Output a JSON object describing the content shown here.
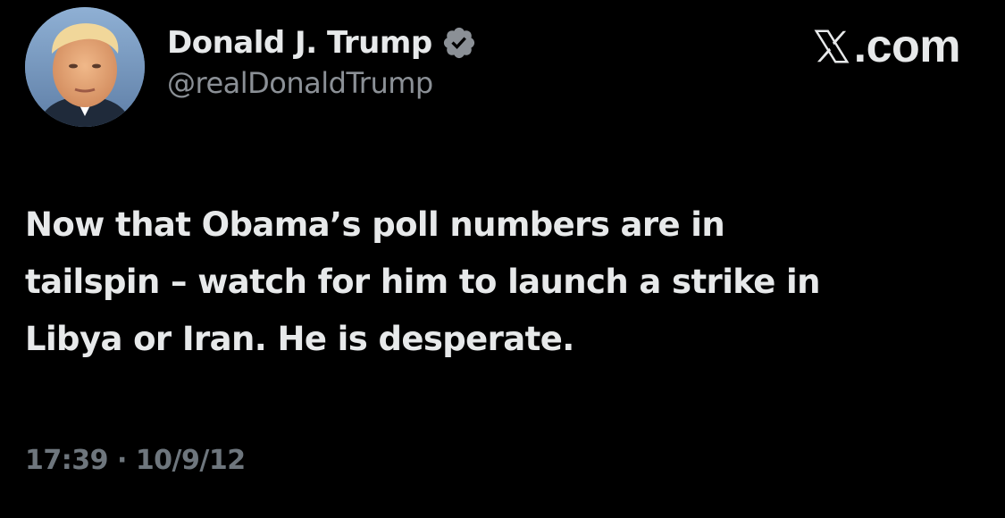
{
  "author": {
    "display_name": "Donald J. Trump",
    "handle": "@realDonaldTrump",
    "verified": true,
    "verified_icon": "verified-badge-icon",
    "avatar_icon": "profile-avatar"
  },
  "brand": {
    "icon": "x-logo-icon",
    "label": ".com"
  },
  "tweet": {
    "text": "Now that Obama’s poll numbers are in\ntailspin – watch for him to launch a strike in\nLibya or Iran.  He is desperate.",
    "time": "17:39",
    "separator": "·",
    "date": "10/9/12"
  },
  "colors": {
    "background": "#000000",
    "primary_text": "#e7e9ea",
    "secondary_text": "#8b9096",
    "timestamp_text": "#6e767d"
  }
}
